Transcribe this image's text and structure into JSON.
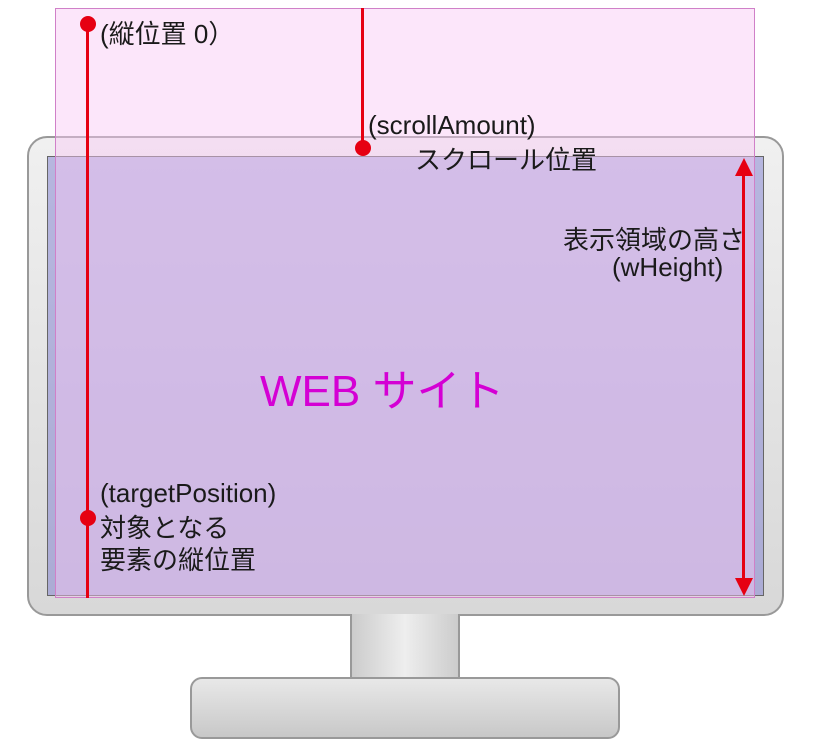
{
  "labels": {
    "topPosition": "(縦位置 0）",
    "scrollAmountVar": "(scrollAmount)",
    "scrollAmountJp": "スクロール位置",
    "heightJp": "表示領域の高さ",
    "heightVar": "(wHeight)",
    "webTitle": "WEB サイト",
    "targetVar": "(targetPosition)",
    "targetJp1": "対象となる",
    "targetJp2": "要素の縦位置"
  },
  "colors": {
    "accent": "#e60012",
    "magenta": "#d400d4",
    "pageFill": "rgba(248,200,245,0.45)",
    "screenFill": "rgba(135,135,210,0.55)"
  }
}
